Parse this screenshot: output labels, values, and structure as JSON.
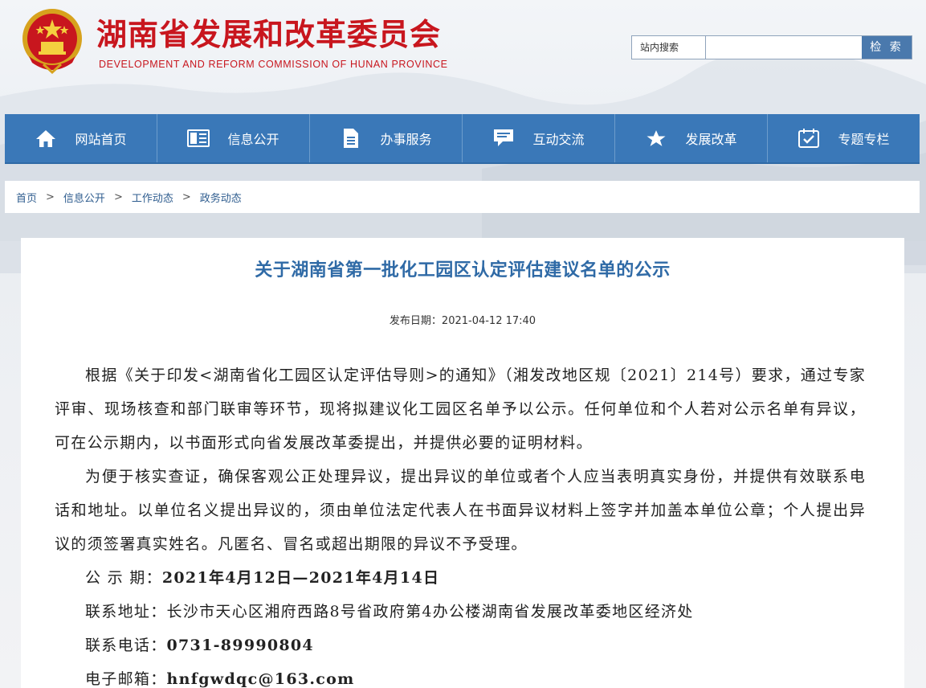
{
  "header": {
    "site_name": "湖南省发展和改革委员会",
    "site_name_en": "DEVELOPMENT AND REFORM COMMISSION OF HUNAN PROVINCE",
    "search_label": "站内搜索",
    "search_placeholder": "",
    "search_button": "检 索"
  },
  "nav": {
    "items": [
      {
        "label": "网站首页",
        "icon": "home-icon"
      },
      {
        "label": "信息公开",
        "icon": "info-icon"
      },
      {
        "label": "办事服务",
        "icon": "document-icon"
      },
      {
        "label": "互动交流",
        "icon": "chat-icon"
      },
      {
        "label": "发展改革",
        "icon": "star-icon"
      },
      {
        "label": "专题专栏",
        "icon": "calendar-check-icon"
      }
    ]
  },
  "breadcrumb": [
    "首页",
    "信息公开",
    "工作动态",
    "政务动态"
  ],
  "breadcrumb_separator": ">",
  "article": {
    "title": "关于湖南省第一批化工园区认定评估建议名单的公示",
    "pubdate": "发布日期：2021-04-12 17:40",
    "paragraphs": [
      "根据《关于印发<湖南省化工园区认定评估导则>的通知》（湘发改地区规〔2021〕214号）要求，通过专家评审、现场核查和部门联审等环节，现将拟建议化工园区名单予以公示。任何单位和个人若对公示名单有异议，可在公示期内，以书面形式向省发展改革委提出，并提供必要的证明材料。",
      "为便于核实查证，确保客观公正处理异议，提出异议的单位或者个人应当表明真实身份，并提供有效联系电话和地址。以单位名义提出异议的，须由单位法定代表人在书面异议材料上签字并加盖本单位公章；个人提出异议的须签署真实姓名。凡匿名、冒名或超出期限的异议不予受理。"
    ],
    "period_label": "公 示 期：",
    "period_value": "2021年4月12日—2021年4月14日",
    "address_label": "联系地址：",
    "address_value": "长沙市天心区湘府西路8号省政府第4办公楼湖南省发展改革委地区经济处",
    "phone_label": "联系电话：",
    "phone_value": "0731-89990804",
    "email_label": "电子邮箱：",
    "email_value": "hnfgwdqc@163.com"
  },
  "colors": {
    "brand_red": "#c8161e",
    "nav_blue": "#3a78b8",
    "title_blue": "#2f6aa6"
  }
}
